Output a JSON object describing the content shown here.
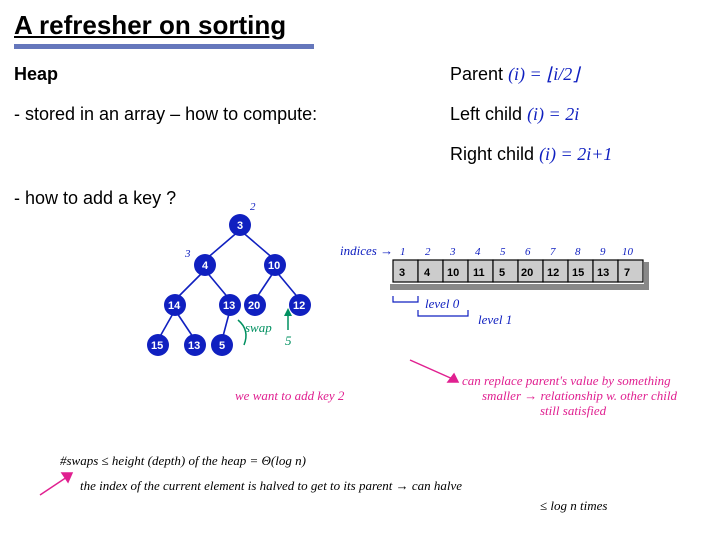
{
  "title": "A refresher on sorting",
  "heap": "Heap",
  "stored": "- stored in an array – how to compute:",
  "parent": "Parent",
  "leftchild": "Left child",
  "rightchild": "Right child",
  "addkey": "- how to add a key ?",
  "formulas": {
    "parent": "(i) = ⌊i/2⌋",
    "left": "(i) = 2i",
    "right": "(i) = 2i+1"
  },
  "tree": {
    "values": [
      "3",
      "4",
      "10",
      "14",
      "13",
      "20",
      "12",
      "15",
      "13",
      "5"
    ],
    "root_label": "2",
    "side_label": "3"
  },
  "array": {
    "indices_label": "indices →",
    "indices": [
      "1",
      "2",
      "3",
      "4",
      "5",
      "6",
      "7",
      "8",
      "9",
      "10"
    ],
    "values": [
      "3",
      "4",
      "10",
      "11",
      "5",
      "20",
      "12",
      "15",
      "13",
      "7"
    ],
    "level0": "level 0",
    "level1": "level 1"
  },
  "notes": {
    "swap": "swap",
    "five": "5",
    "addkey2": "we want to add key 2",
    "replace_1": "can replace parent's value by something",
    "replace_2": "smaller → relationship w. other child",
    "replace_3": "still satisfied",
    "swaps_line": "#swaps ≤ height (depth) of the heap = Θ(log n)",
    "halved_line": "the index of the current element is halved to get to its parent → can halve",
    "halved_tail": "≤ log n times"
  }
}
